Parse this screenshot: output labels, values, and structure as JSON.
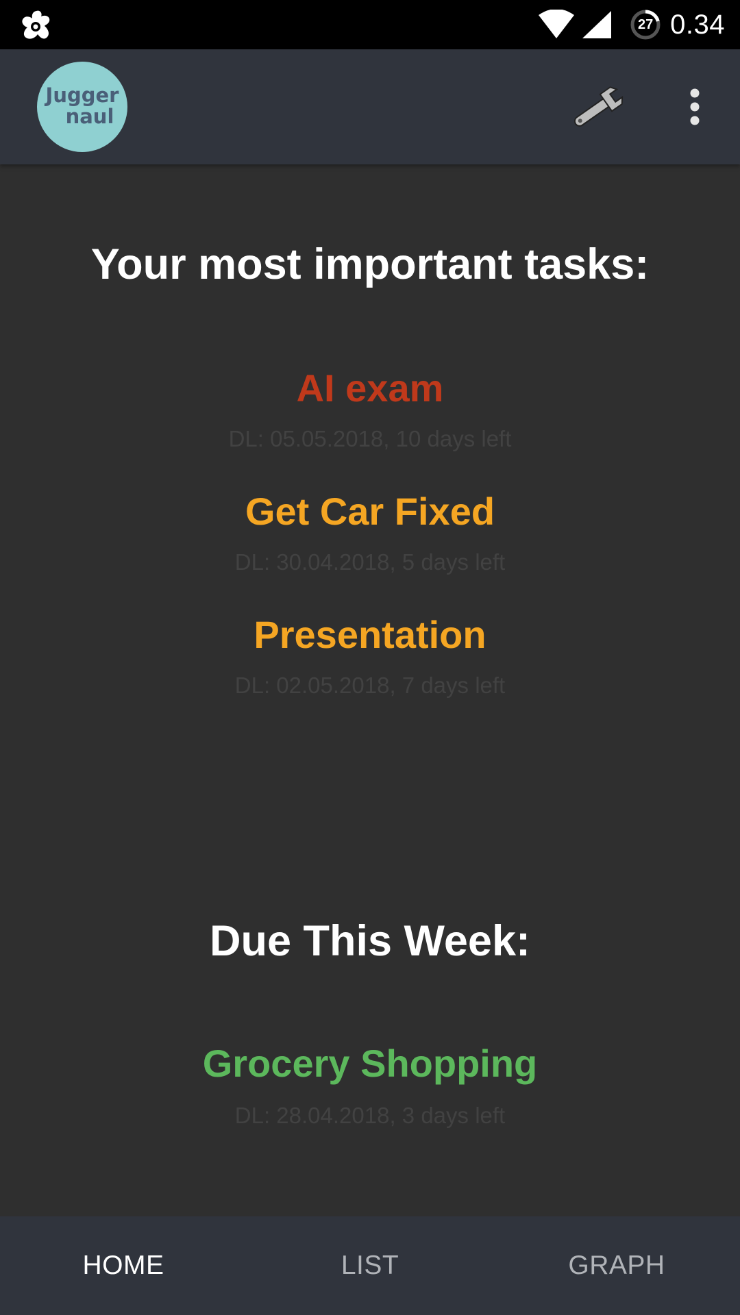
{
  "status_bar": {
    "time": "0.34",
    "battery_level": "27",
    "app_icon": "avast-icon",
    "wifi_icon": "wifi-icon",
    "signal_icon": "cell-signal-icon"
  },
  "app_bar": {
    "logo_line1": "Jugger",
    "logo_line2": "naul",
    "settings_icon": "wrench-icon",
    "overflow_icon": "more-vert-icon"
  },
  "important": {
    "heading": "Your most important tasks:",
    "tasks": [
      {
        "title": "AI exam",
        "deadline": "DL: 05.05.2018, 10 days left",
        "color": "#c0391b"
      },
      {
        "title": "Get Car Fixed",
        "deadline": "DL: 30.04.2018, 5 days left",
        "color": "#f5a623"
      },
      {
        "title": "Presentation",
        "deadline": "DL: 02.05.2018, 7 days left",
        "color": "#f5a623"
      }
    ]
  },
  "due_week": {
    "heading": "Due This Week:",
    "tasks": [
      {
        "title": "Grocery Shopping",
        "deadline": "DL: 28.04.2018, 3 days left",
        "color": "#5cb85c"
      }
    ]
  },
  "bottom_nav": {
    "tabs": [
      {
        "label": "HOME",
        "active": true
      },
      {
        "label": "LIST",
        "active": false
      },
      {
        "label": "GRAPH",
        "active": false
      }
    ]
  },
  "colors": {
    "background": "#2f2f2f",
    "app_bar": "#30343d",
    "logo": "#8fd0d1",
    "deadline_text": "#424242"
  }
}
